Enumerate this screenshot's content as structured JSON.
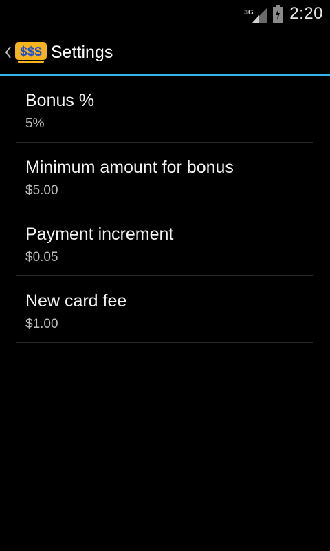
{
  "status_bar": {
    "network_type": "3G",
    "time": "2:20"
  },
  "action_bar": {
    "title": "Settings",
    "app_icon_text": "$$$",
    "accent_color": "#33b5e5",
    "icon_color": "#f5b41e"
  },
  "preferences": [
    {
      "title": "Bonus %",
      "summary": "5%"
    },
    {
      "title": "Minimum amount for bonus",
      "summary": "$5.00"
    },
    {
      "title": "Payment increment",
      "summary": "$0.05"
    },
    {
      "title": "New card fee",
      "summary": "$1.00"
    }
  ]
}
